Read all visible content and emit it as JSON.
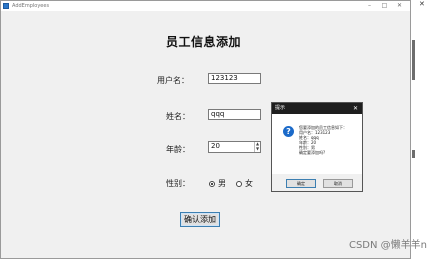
{
  "window": {
    "title": "AddEmployees",
    "controls": [
      "–",
      "□",
      "✕"
    ]
  },
  "form": {
    "heading": "员工信息添加",
    "username_label": "用户名：",
    "username_value": "123123",
    "name_label": "姓名：",
    "name_value": "qqq",
    "age_label": "年龄：",
    "age_value": "20",
    "gender_label": "性别：",
    "gender_options": [
      "男",
      "女"
    ],
    "gender_selected": "男",
    "confirm_button": "确认添加"
  },
  "dialog": {
    "title": "提示",
    "close": "✕",
    "icon": "info-question-icon",
    "lines": [
      "您要添加的员工信息如下：",
      "用户名：123123",
      "姓名：qqq",
      "年龄：20",
      "性别：男",
      "确定要添加吗?"
    ],
    "ok_button": "确定",
    "cancel_button": "取消"
  },
  "outer": {
    "close": "✕"
  },
  "watermark": "CSDN @懒羊羊n"
}
